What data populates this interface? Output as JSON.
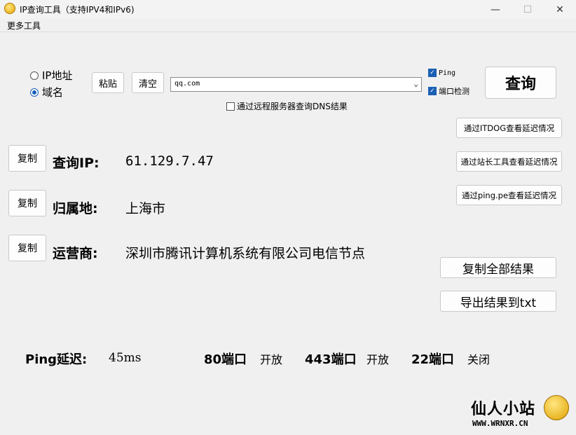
{
  "window": {
    "title": "IP查询工具（支持IPV4和IPv6)",
    "minimize": "—",
    "maximize": "☐",
    "close": "✕"
  },
  "menu": {
    "more_tools": "更多工具"
  },
  "query": {
    "radio_ip": "IP地址",
    "radio_domain": "域名",
    "selected": "域名",
    "paste_label": "粘贴",
    "clear_label": "清空",
    "input_value": "qq.com",
    "ping_label": "Ping",
    "ping_checked": true,
    "port_label": "端口检测",
    "port_checked": true,
    "remote_dns_label": "通过远程服务器查询DNS结果",
    "remote_dns_checked": false,
    "query_label": "查询"
  },
  "side_buttons": {
    "itdog": "通过ITDOG查看延迟情况",
    "chinaz": "通过站长工具查看延迟情况",
    "pingpe": "通过ping.pe查看延迟情况",
    "copy_all": "复制全部结果",
    "export_txt": "导出结果到txt"
  },
  "results": {
    "copy_label": "复制",
    "ip_label": "查询IP:",
    "ip_value": "61.129.7.47",
    "location_label": "归属地:",
    "location_value": "上海市",
    "isp_label": "运营商:",
    "isp_value": "深圳市腾讯计算机系统有限公司电信节点"
  },
  "status": {
    "ping_label": "Ping延迟:",
    "ping_value": "45ms",
    "port80_label": "80端口",
    "port80_value": "开放",
    "port443_label": "443端口",
    "port443_value": "开放",
    "port22_label": "22端口",
    "port22_value": "关闭"
  },
  "watermark": {
    "title": "仙人小站",
    "url": "WWW.WRNXR.CN"
  },
  "icons": [
    "app-icon",
    "chevron-down-icon",
    "check-icon",
    "mascot-icon"
  ]
}
